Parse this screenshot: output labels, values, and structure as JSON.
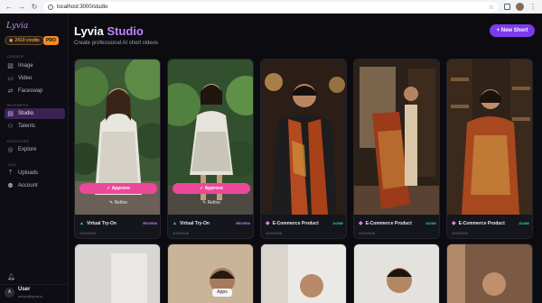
{
  "browser": {
    "url": "localhost:3000/studio"
  },
  "sidebar": {
    "logo": "Lyvia",
    "credits": "2419 credits",
    "badge": "PRO",
    "sections": {
      "create": "CREATE",
      "business": "BUSINESS",
      "discover": "DISCOVER",
      "you": "YOU"
    },
    "items": [
      {
        "label": "Image",
        "icon": "image-icon"
      },
      {
        "label": "Video",
        "icon": "video-icon"
      },
      {
        "label": "Faceswap",
        "icon": "faceswap-icon"
      },
      {
        "label": "Studio",
        "icon": "studio-icon",
        "active": true
      },
      {
        "label": "Talents",
        "icon": "talents-icon"
      },
      {
        "label": "Explore",
        "icon": "explore-icon"
      },
      {
        "label": "Uploads",
        "icon": "uploads-icon"
      },
      {
        "label": "Account",
        "icon": "account-icon"
      }
    ],
    "user": {
      "name": "User",
      "email": "admin@lyvia.io",
      "initial": "A"
    }
  },
  "header": {
    "title_main": "Lyvia ",
    "title_accent": "Studio",
    "subtitle": "Create professional AI short videos",
    "new_button": "+ New Short"
  },
  "cards": [
    {
      "title": "Virtual Try-On",
      "status": "REVIEW",
      "date": "4/22/2026",
      "approve": "Approve",
      "refine": "Refine"
    },
    {
      "title": "Virtual Try-On",
      "status": "REVIEW",
      "date": "4/20/2026",
      "approve": "Approve",
      "refine": "Refine"
    },
    {
      "title": "E-Commerce Product",
      "status": "DONE",
      "date": "4/19/2026"
    },
    {
      "title": "E-Commerce Product",
      "status": "DONE",
      "date": "4/19/2026"
    },
    {
      "title": "E-Commerce Product",
      "status": "DONE",
      "date": "4/18/2026"
    }
  ],
  "tooltip": "Apps",
  "colors": {
    "accent": "#7c3aed",
    "approve": "#ec4899",
    "review": "#c084fc",
    "done": "#34d399"
  }
}
